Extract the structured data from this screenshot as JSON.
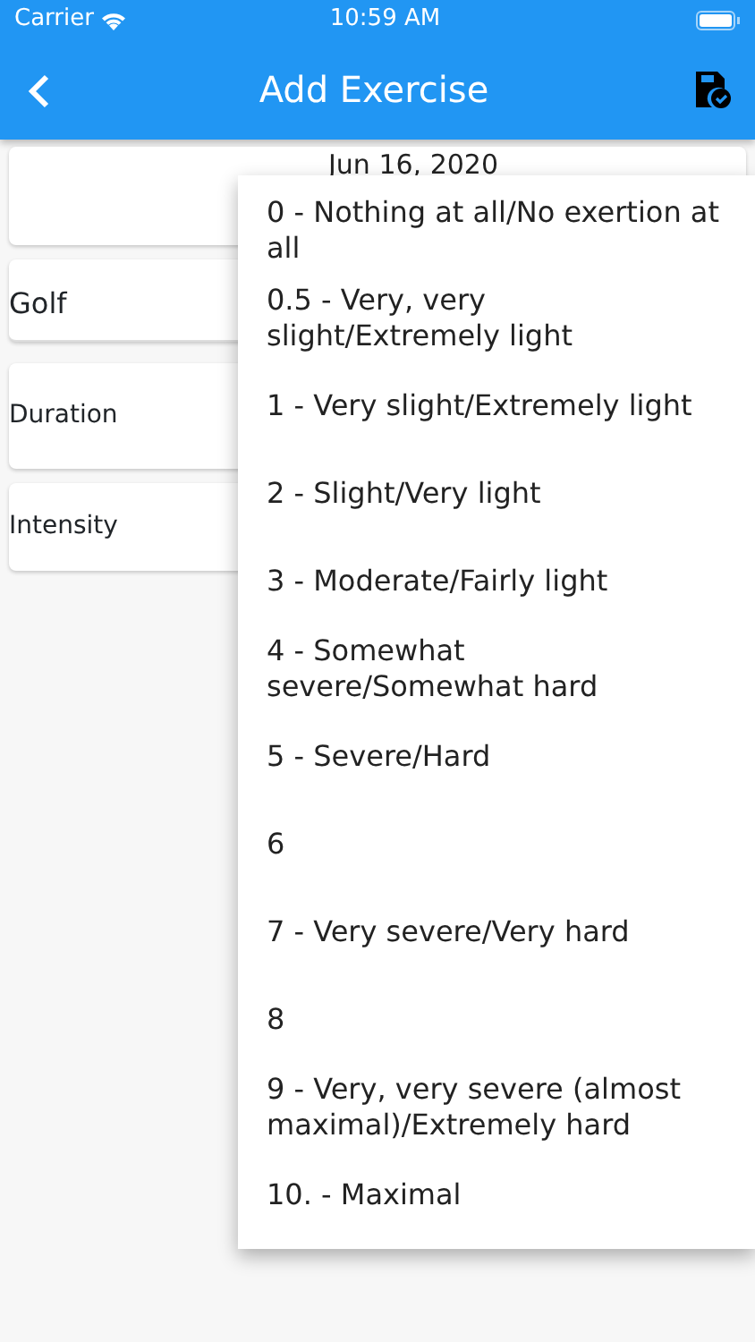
{
  "status_bar": {
    "carrier": "Carrier",
    "time": "10:59 AM"
  },
  "app_bar": {
    "title": "Add Exercise"
  },
  "form": {
    "date": "Jun 16, 2020",
    "exercise": "Golf",
    "fields": [
      {
        "label": "Duration"
      },
      {
        "label": "Intensity"
      }
    ]
  },
  "dropdown": {
    "options": [
      {
        "label": "0 - Nothing at all/No exertion at all"
      },
      {
        "label": "0.5 - Very, very slight/Extremely light"
      },
      {
        "label": "1 - Very slight/Extremely light"
      },
      {
        "label": "2 - Slight/Very light"
      },
      {
        "label": "3 - Moderate/Fairly light"
      },
      {
        "label": "4 - Somewhat severe/Somewhat hard"
      },
      {
        "label": "5 - Severe/Hard"
      },
      {
        "label": "6"
      },
      {
        "label": "7 - Very severe/Very hard"
      },
      {
        "label": "8"
      },
      {
        "label": "9 - Very, very severe (almost maximal)/Extremely hard"
      },
      {
        "label": "10. - Maximal"
      }
    ]
  }
}
